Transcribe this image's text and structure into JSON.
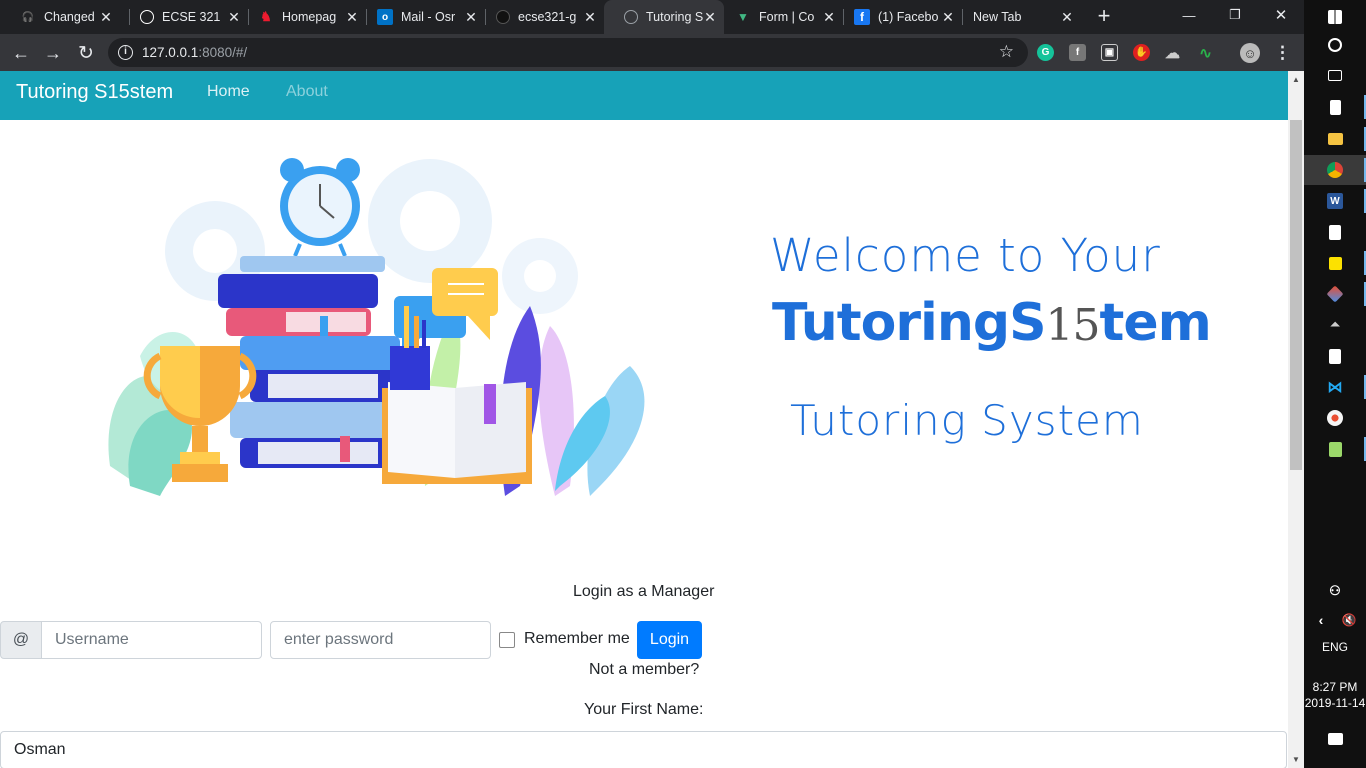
{
  "browser": {
    "tabs": [
      {
        "title": "Changed",
        "favicon": "headset-icon",
        "color": "#ffffff"
      },
      {
        "title": "ECSE 321",
        "favicon": "globe-icon",
        "color": "#ffffff"
      },
      {
        "title": "Homepag",
        "favicon": "mcgill-icon",
        "color": "#ed1b2f"
      },
      {
        "title": "Mail - Osr",
        "favicon": "outlook-icon",
        "color": "#0072c6"
      },
      {
        "title": "ecse321-g",
        "favicon": "github-icon",
        "color": "#000000"
      },
      {
        "title": "Tutoring S",
        "favicon": "globe-icon",
        "color": "#9aa0a6",
        "active": true
      },
      {
        "title": "Form | Co",
        "favicon": "vue-icon",
        "color": "#41b883"
      },
      {
        "title": "(1) Facebo",
        "favicon": "facebook-icon",
        "color": "#1877f2"
      },
      {
        "title": "New Tab",
        "favicon": "",
        "color": ""
      }
    ],
    "new_tab": "+",
    "window_buttons": {
      "minimize": "—",
      "restore": "❐",
      "close": "✕"
    },
    "url_host": "127.0.0.1",
    "url_rest": ":8080/#/",
    "extensions": [
      {
        "name": "grammarly-icon",
        "color": "#15c39a",
        "glyph": "G"
      },
      {
        "name": "facebook-ext-icon",
        "color": "#555555",
        "glyph": "f"
      },
      {
        "name": "screen-capture-icon",
        "color": "#555555",
        "glyph": "▣"
      },
      {
        "name": "adblock-icon",
        "color": "#e02020",
        "glyph": "✋"
      },
      {
        "name": "cloud-icon",
        "color": "#35363a",
        "glyph": "☁"
      },
      {
        "name": "pulse-icon",
        "color": "#35363a",
        "glyph": "∿"
      },
      {
        "name": "profile-icon",
        "color": "#5f6368",
        "glyph": "☺"
      },
      {
        "name": "menu-icon",
        "color": "#35363a",
        "glyph": "⋮"
      }
    ]
  },
  "navbar": {
    "brand": "Tutoring S15stem",
    "links": {
      "home": "Home",
      "about": "About"
    }
  },
  "hero": {
    "welcome": "Welcome to Your",
    "logo_prefix": "TutoringS",
    "logo_mid": "15",
    "logo_suffix": "tem",
    "tagline": "Tutoring System"
  },
  "login": {
    "heading": "Login as a Manager",
    "at_prefix": "@",
    "username_placeholder": "Username",
    "password_placeholder": "enter password",
    "remember_label": "Remember me",
    "login_button": "Login",
    "not_member": "Not a member?",
    "first_name_label": "Your First Name:",
    "first_name_value": "Osman"
  },
  "taskbar": {
    "language": "ENG",
    "time": "8:27 PM",
    "date": "2019-11-14"
  },
  "colors": {
    "navbar_bg": "#17a2b8",
    "primary_button": "#007bff",
    "hero_blue": "#1e6fd9"
  }
}
